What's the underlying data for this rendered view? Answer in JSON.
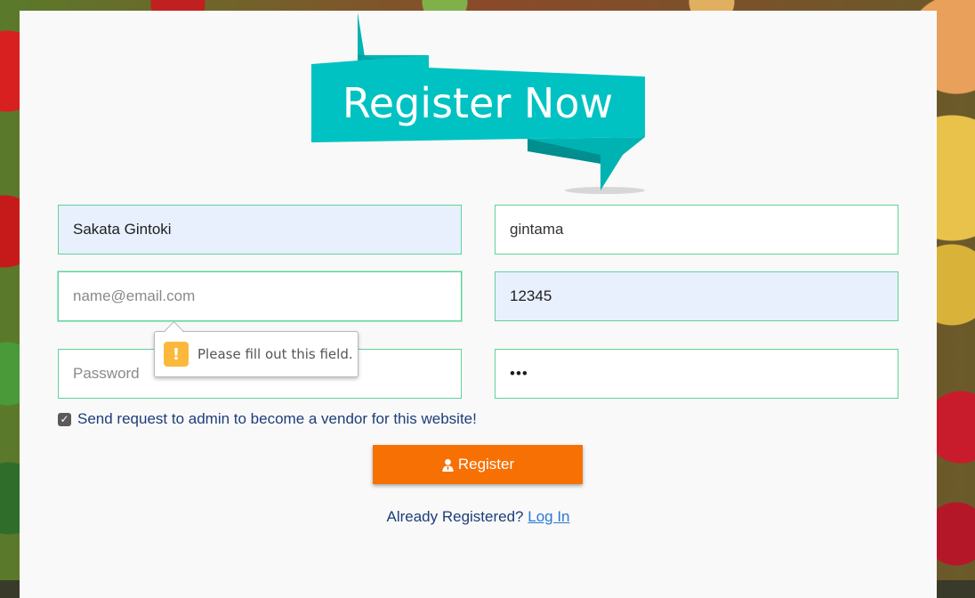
{
  "banner": {
    "title": "Register Now"
  },
  "form": {
    "fullname": {
      "value": "Sakata Gintoki",
      "placeholder": ""
    },
    "username": {
      "value": "gintama",
      "placeholder": ""
    },
    "email": {
      "value": "",
      "placeholder": "name@email.com"
    },
    "phone": {
      "value": "12345",
      "placeholder": ""
    },
    "password": {
      "value": "",
      "placeholder": "Password"
    },
    "confirm_password": {
      "value": "123",
      "placeholder": ""
    }
  },
  "validation": {
    "message": "Please fill out this field.",
    "icon": "exclamation-icon"
  },
  "vendor_checkbox": {
    "checked": true,
    "label": "Send request to admin to become a vendor for this website!"
  },
  "register_button": {
    "label": "Register",
    "icon": "user-tie-icon"
  },
  "login": {
    "prompt": "Already Registered?",
    "link_label": "Log In"
  },
  "colors": {
    "accent": "#f77004",
    "banner": "#00c2c2",
    "field_border": "#5fd39a",
    "text": "#1d3d7a"
  }
}
